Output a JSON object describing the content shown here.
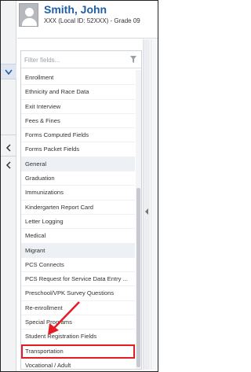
{
  "student": {
    "name": "Smith, John",
    "meta": "XXX (Local ID: 52XXX) - Grade 09"
  },
  "search": {
    "placeholder": "Filter fields..."
  },
  "fields": [
    {
      "label": "Enrollment",
      "type": "item"
    },
    {
      "label": "Ethnicity and Race Data",
      "type": "item"
    },
    {
      "label": "Exit Interview",
      "type": "item"
    },
    {
      "label": "Fees & Fines",
      "type": "item"
    },
    {
      "label": "Forms Computed Fields",
      "type": "item"
    },
    {
      "label": "Forms Packet Fields",
      "type": "item"
    },
    {
      "label": "General",
      "type": "group"
    },
    {
      "label": "Graduation",
      "type": "item"
    },
    {
      "label": "Immunizations",
      "type": "item"
    },
    {
      "label": "Kindergarten Report Card",
      "type": "item"
    },
    {
      "label": "Letter Logging",
      "type": "item"
    },
    {
      "label": "Medical",
      "type": "item"
    },
    {
      "label": "Migrant",
      "type": "group"
    },
    {
      "label": "PCS Connects",
      "type": "item"
    },
    {
      "label": "PCS Request for Service Data Entry ...",
      "type": "item"
    },
    {
      "label": "Preschool/VPK Survey Questions",
      "type": "item"
    },
    {
      "label": "Re-enrollment",
      "type": "item"
    },
    {
      "label": "Special Programs",
      "type": "item"
    },
    {
      "label": "Student Registration Fields",
      "type": "item"
    },
    {
      "label": "Transportation",
      "type": "item",
      "highlighted": true
    },
    {
      "label": "Vocational / Adult",
      "type": "item"
    }
  ],
  "colors": {
    "name": "#1f5fa8",
    "highlight": "#e41c24",
    "group_bg": "#edf0f4"
  },
  "icons": {
    "avatar": "person-silhouette-icon",
    "filter": "funnel-icon",
    "collapse": "chevron-left-icon",
    "expand": "chevron-down-icon"
  }
}
